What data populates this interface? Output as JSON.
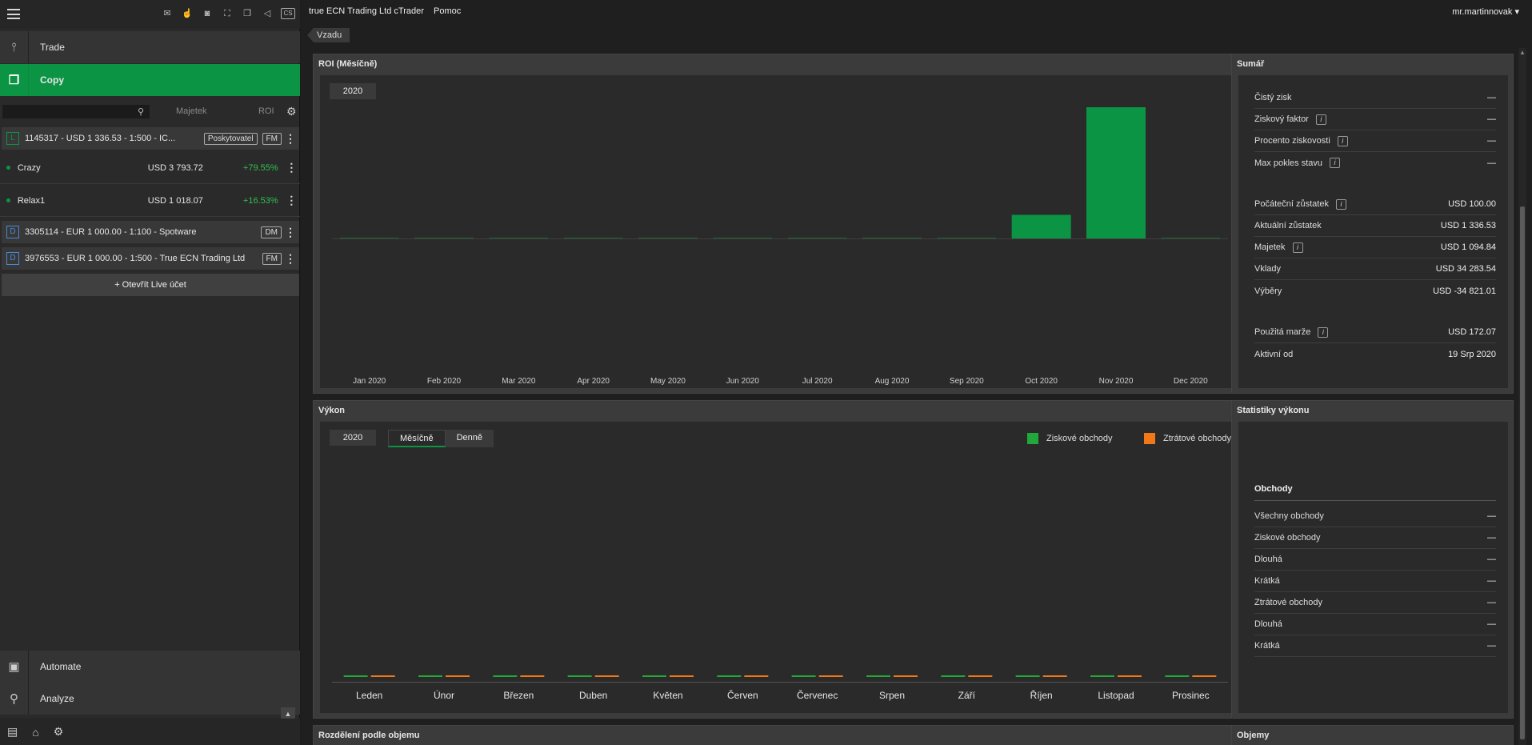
{
  "sidebar": {
    "topbar_icons": [
      {
        "icon": "mail-icon",
        "glyph": "✉"
      },
      {
        "icon": "hand-icon",
        "glyph": "☝"
      },
      {
        "icon": "camera-icon",
        "glyph": "◙"
      },
      {
        "icon": "fullscreen-icon",
        "glyph": "⛶"
      },
      {
        "icon": "windows-icon",
        "glyph": "❐"
      },
      {
        "icon": "sound-icon",
        "glyph": "◁"
      },
      {
        "icon": "language-icon",
        "glyph": "CS"
      }
    ],
    "nav_trade": "Trade",
    "nav_copy": "Copy",
    "search_placeholder": "",
    "col_majetek": "Majetek",
    "col_roi": "ROI",
    "accounts": [
      {
        "badge": "L",
        "text": "1145317 - USD 1 336.53 - 1:500 - IC...",
        "tags": [
          "Poskytovatel",
          "FM"
        ]
      },
      {
        "badge": "D",
        "text": "3305114 - EUR 1 000.00 - 1:100 - Spotware",
        "tags": [
          "DM"
        ]
      },
      {
        "badge": "D",
        "text": "3976553 - EUR 1 000.00 - 1:500 - True ECN Trading Ltd",
        "tags": [
          "FM"
        ]
      }
    ],
    "strategies": [
      {
        "name": "Crazy",
        "value": "USD 3 793.72",
        "roi": "+79.55%"
      },
      {
        "name": "Relax1",
        "value": "USD 1 018.07",
        "roi": "+16.53%"
      }
    ],
    "open_live": "+ Otevřít Live účet",
    "nav_automate": "Automate",
    "nav_analyze": "Analyze"
  },
  "header": {
    "broker": "true ECN Trading Ltd cTrader",
    "help": "Pomoc",
    "user": "mr.martinnovak",
    "back": "Vzadu"
  },
  "roi": {
    "title": "ROI (Měsíčně)",
    "year": "2020"
  },
  "summary": {
    "title": "Sumář",
    "rows": [
      {
        "label": "Čistý zisk",
        "value": "—",
        "info": false
      },
      {
        "label": "Ziskový faktor",
        "value": "—",
        "info": true
      },
      {
        "label": "Procento ziskovosti",
        "value": "—",
        "info": true
      },
      {
        "label": "Max pokles stavu",
        "value": "—",
        "info": true
      },
      {
        "label": "Počáteční zůstatek",
        "value": "USD 100.00",
        "info": true
      },
      {
        "label": "Aktuální zůstatek",
        "value": "USD 1 336.53",
        "info": false
      },
      {
        "label": "Majetek",
        "value": "USD 1 094.84",
        "info": true
      },
      {
        "label": "Vklady",
        "value": "USD 34 283.54",
        "info": false
      },
      {
        "label": "Výběry",
        "value": "USD -34 821.01",
        "info": false
      },
      {
        "label": "Použitá marže",
        "value": "USD 172.07",
        "info": true
      },
      {
        "label": "Aktivní od",
        "value": "19 Srp 2020",
        "info": false
      }
    ]
  },
  "performance": {
    "title": "Výkon",
    "year": "2020",
    "tab_monthly": "Měsíčně",
    "tab_daily": "Denně",
    "legend_profit": "Ziskové obchody",
    "legend_loss": "Ztrátové obchody"
  },
  "stats": {
    "title": "Statistiky výkonu",
    "section": "Obchody",
    "rows": [
      {
        "label": "Všechny obchody",
        "value": "—"
      },
      {
        "label": "Ziskové obchody",
        "value": "—"
      },
      {
        "label": "Dlouhá",
        "value": "—"
      },
      {
        "label": "Krátká",
        "value": "—"
      },
      {
        "label": "Ztrátové obchody",
        "value": "—"
      },
      {
        "label": "Dlouhá",
        "value": "—"
      },
      {
        "label": "Krátká",
        "value": "—"
      }
    ]
  },
  "bottom_panels": {
    "volume_split": "Rozdělení podle objemu",
    "volumes": "Objemy"
  },
  "colors": {
    "accent": "#0b9444",
    "profit": "#22a83a",
    "loss": "#f07818"
  },
  "chart_data": [
    {
      "type": "bar",
      "name": "roi-monthly",
      "categories": [
        "Jan 2020",
        "Feb 2020",
        "Mar 2020",
        "Apr 2020",
        "May 2020",
        "Jun 2020",
        "Jul 2020",
        "Aug 2020",
        "Sep 2020",
        "Oct 2020",
        "Nov 2020",
        "Dec 2020"
      ],
      "values": [
        0,
        0,
        0,
        0,
        0,
        0,
        0,
        0,
        0,
        18,
        100,
        0
      ],
      "ylim": [
        0,
        100
      ]
    },
    {
      "type": "bar",
      "name": "performance-monthly",
      "categories": [
        "Leden",
        "Únor",
        "Březen",
        "Duben",
        "Květen",
        "Červen",
        "Červenec",
        "Srpen",
        "Září",
        "Říjen",
        "Listopad",
        "Prosinec"
      ],
      "series": [
        {
          "name": "Ziskové obchody",
          "values": [
            0,
            0,
            0,
            0,
            0,
            0,
            0,
            0,
            0,
            0,
            0,
            0
          ]
        },
        {
          "name": "Ztrátové obchody",
          "values": [
            0,
            0,
            0,
            0,
            0,
            0,
            0,
            0,
            0,
            0,
            0,
            0
          ]
        }
      ]
    }
  ]
}
